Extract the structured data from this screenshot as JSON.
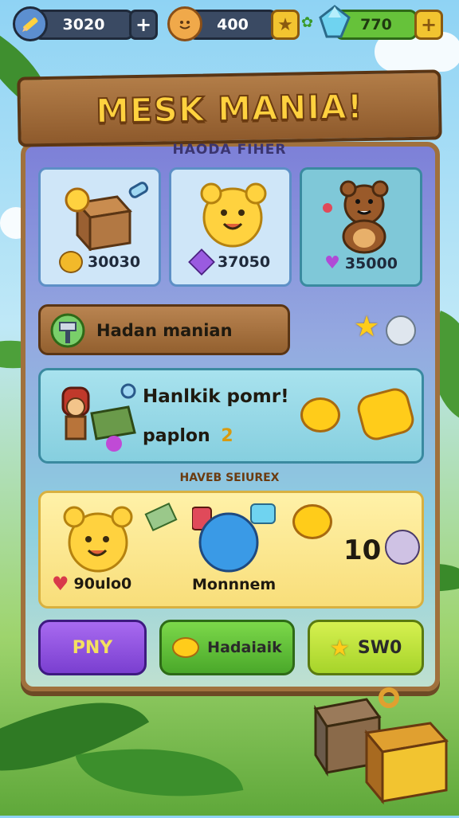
{
  "resources": {
    "coins": "3020",
    "coins_add": "+",
    "energy": "400",
    "gems": "770"
  },
  "header": {
    "title": "MESK MANIA!",
    "subtitle": "HAODA FIHER"
  },
  "shop_cards": [
    {
      "price": "30030"
    },
    {
      "price": "37050"
    },
    {
      "price": "35000"
    }
  ],
  "menu": {
    "item_label": "Hadan manian"
  },
  "promo": {
    "line1": "Hanlkik pomr!",
    "line2": "paplon",
    "line2_number": "2"
  },
  "section_label": "HAVEB SEIUREX",
  "featured": {
    "price": "90ulo0",
    "name": "Monnnem",
    "count": "10"
  },
  "buttons": {
    "play": "PNY",
    "middle": "Hadaiaik",
    "right": "SW0"
  },
  "colors": {
    "gold": "#ffd23f",
    "wood": "#a0713d",
    "purple_button": "#8b4fd6",
    "green_button": "#5cbf3a",
    "lime_button": "#b7e43a"
  }
}
